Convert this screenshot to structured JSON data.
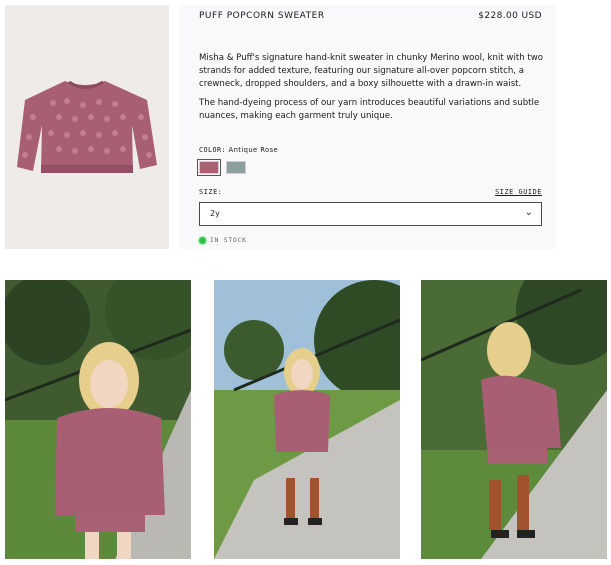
{
  "product": {
    "title": "PUFF POPCORN SWEATER",
    "price": "$228.00 USD",
    "description": [
      "Misha & Puff's signature hand-knit sweater in chunky Merino wool, knit with two strands for added texture, featuring our signature all-over popcorn stitch, a crewneck, dropped shoulders, and a boxy silhouette with a drawn-in waist.",
      "The hand-dyeing process of our yarn introduces beautiful variations and subtle nuances, making each garment truly unique."
    ]
  },
  "color": {
    "label": "COLOR:",
    "selected": "Antique Rose",
    "swatches": [
      {
        "name": "Antique Rose",
        "hex": "#a86072"
      },
      {
        "name": "Sage",
        "hex": "#8ea09c"
      }
    ]
  },
  "size": {
    "label": "SIZE:",
    "guide": "SIZE GUIDE",
    "selected": "2y"
  },
  "stock": {
    "label": "IN STOCK",
    "color": "#2fc14a"
  },
  "icons": {
    "dropdown": "chevron-down-icon",
    "stock": "status-dot-icon"
  }
}
